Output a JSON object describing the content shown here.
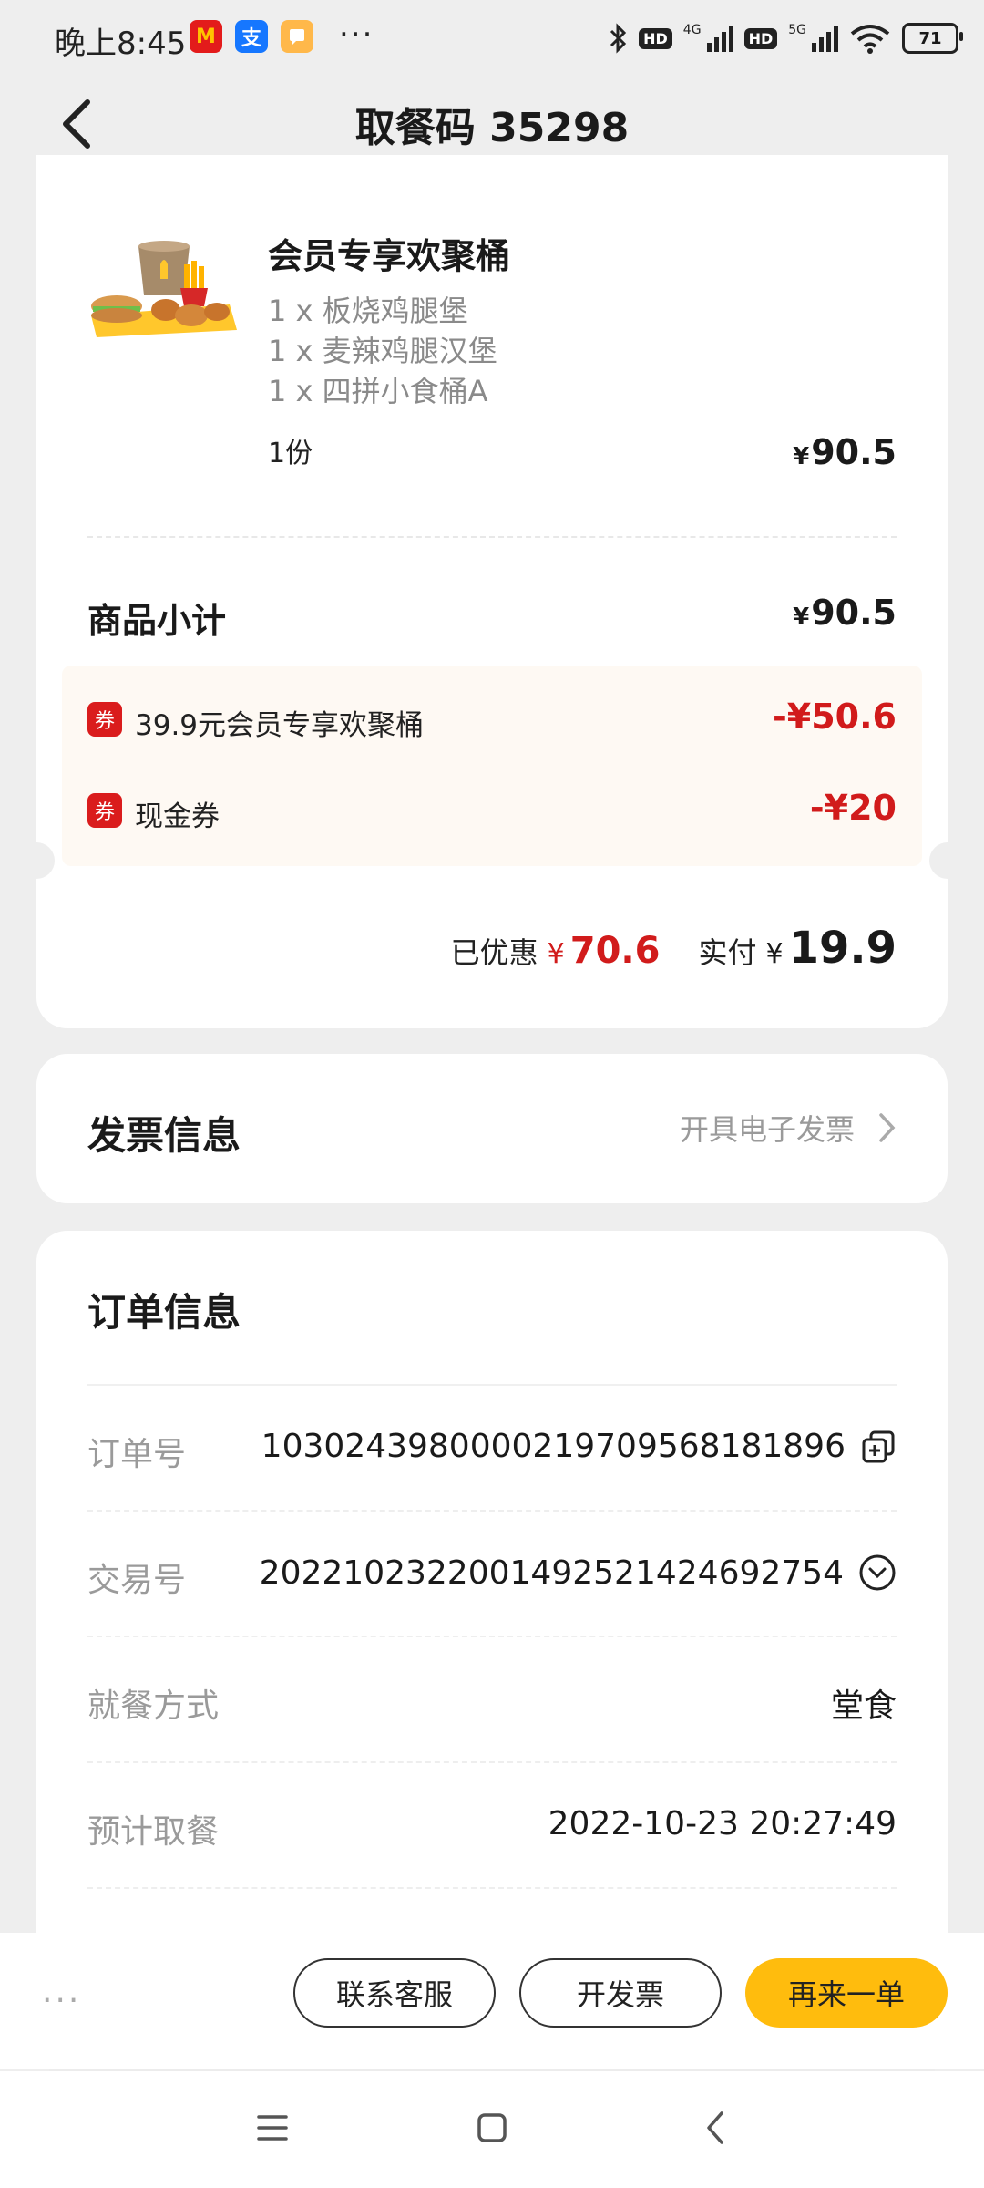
{
  "status_bar": {
    "time": "晚上8:45",
    "dots": "···",
    "net1": "4G",
    "net2": "5G",
    "hd": "HD",
    "battery": "71"
  },
  "header": {
    "title": "取餐码 35298"
  },
  "order": {
    "product_name": "会员专享欢聚桶",
    "items": [
      "1 x 板烧鸡腿堡",
      "1 x 麦辣鸡腿汉堡",
      "1 x 四拼小食桶A"
    ],
    "quantity": "1份",
    "currency": "¥",
    "price": "90.5",
    "subtotal_label": "商品小计",
    "subtotal": "90.5",
    "coupon_badge": "券",
    "discounts": [
      {
        "label": "39.9元会员专享欢聚桶",
        "amount": "-¥50.6"
      },
      {
        "label": "现金券",
        "amount": "-¥20"
      }
    ],
    "saved_label": "已优惠",
    "saved_amount": "70.6",
    "paid_label": "实付",
    "paid_amount": "19.9"
  },
  "invoice": {
    "title": "发票信息",
    "action": "开具电子发票"
  },
  "info": {
    "title": "订单信息",
    "rows": [
      {
        "label": "订单号",
        "value": "1030243980000219709568181896"
      },
      {
        "label": "交易号",
        "value": "2022102322001492521424692754"
      },
      {
        "label": "就餐方式",
        "value": "堂食"
      },
      {
        "label": "预计取餐",
        "value": "2022-10-23 20:27:49"
      }
    ]
  },
  "actions": {
    "more": "···",
    "contact": "联系客服",
    "invoice": "开发票",
    "reorder": "再来一单"
  },
  "colors": {
    "accent": "#ffbc0d",
    "discount_red": "#d11b1b",
    "background": "#eeeeee"
  }
}
